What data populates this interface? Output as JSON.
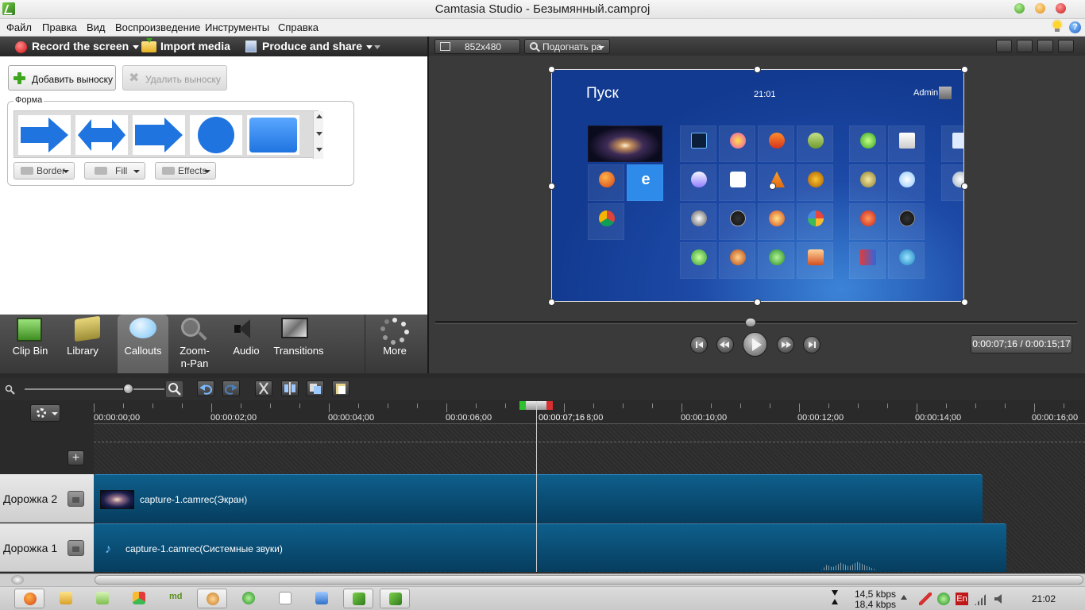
{
  "window": {
    "title": "Camtasia Studio - Безымянный.camproj"
  },
  "menu": [
    "Файл",
    "Правка",
    "Вид",
    "Воспроизведение",
    "Инструменты",
    "Справка"
  ],
  "toolbar": {
    "record_label": "Record the screen",
    "import_label": "Import media",
    "produce_label": "Produce and share"
  },
  "callouts": {
    "add_label": "Добавить выноску",
    "delete_label": "Удалить выноску",
    "shape_group_label": "Форма",
    "shapes": [
      "arrow-right",
      "arrow-double",
      "arrow-chevron",
      "circle",
      "rectangle"
    ],
    "border_label": "Border",
    "fill_label": "Fill",
    "effects_label": "Effects",
    "shape_color": "#1f74e0"
  },
  "tabs": [
    {
      "label": "Clip Bin",
      "icon": "film-icon"
    },
    {
      "label": "Library",
      "icon": "library-icon"
    },
    {
      "label": "Callouts",
      "icon": "callout-icon",
      "active": true
    },
    {
      "label": "Zoom-n-Pan",
      "icon": "zoom-icon"
    },
    {
      "label": "Audio",
      "icon": "speaker-icon"
    },
    {
      "label": "Transitions",
      "icon": "transitions-icon"
    },
    {
      "label": "More",
      "icon": "more-icon"
    }
  ],
  "preview": {
    "dimensions": "852x480",
    "zoom_mode": "Подогнать  ра",
    "time_display": "0:00:07;16 / 0:00:15;17",
    "progress_fraction": 0.48,
    "screen": {
      "start_title": "Пуск",
      "time": "21:01",
      "user": "Admin"
    }
  },
  "timeline": {
    "ticks": [
      "00:00:00;00",
      "00:00:02;00",
      "00:00:04;00",
      "00:00:06;00",
      "00:00:10;00",
      "00:00:12;00",
      "00:00:14;00",
      "00:00:16;00"
    ],
    "playhead_label": "00:00:07;16",
    "playhead_tail": "8;00",
    "tracks": [
      {
        "name": "Дорожка 2",
        "clip": "capture-1.camrec(Экран)"
      },
      {
        "name": "Дорожка 1",
        "clip": "capture-1.camrec(Системные звуки)"
      }
    ]
  },
  "taskbar": {
    "net_down": "14,5 kbps",
    "net_up": "18,4 kbps",
    "clock": "21:02",
    "lang": "En"
  }
}
